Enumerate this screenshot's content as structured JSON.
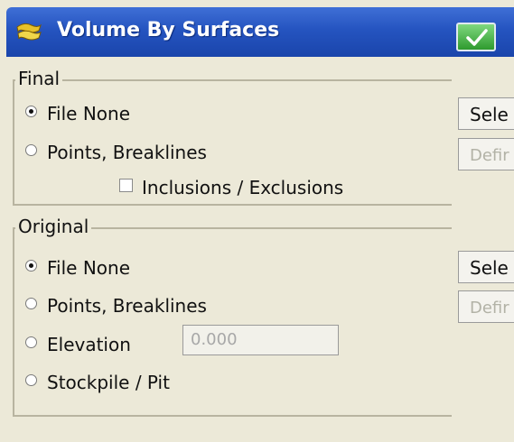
{
  "window": {
    "title": "Volume By Surfaces",
    "ok_icon": "checkmark-icon",
    "app_icon": "surface-icon"
  },
  "final": {
    "legend": "Final",
    "options": [
      {
        "label": "File  None",
        "checked": true
      },
      {
        "label": "Points, Breaklines",
        "checked": false
      }
    ],
    "inclusions_label": "Inclusions / Exclusions",
    "inclusions_checked": false,
    "select_button": "Sele",
    "define_button": "Defir"
  },
  "original": {
    "legend": "Original",
    "options": [
      {
        "label": "File  None",
        "checked": true
      },
      {
        "label": "Points, Breaklines",
        "checked": false
      },
      {
        "label": "Elevation",
        "checked": false
      },
      {
        "label": "Stockpile / Pit",
        "checked": false
      }
    ],
    "elevation_value": "0.000",
    "select_button": "Sele",
    "define_button": "Defir"
  },
  "colors": {
    "title_bar": "#2554c0",
    "ok_button": "#2e9a2e",
    "dialog_bg": "#ece9d8"
  }
}
